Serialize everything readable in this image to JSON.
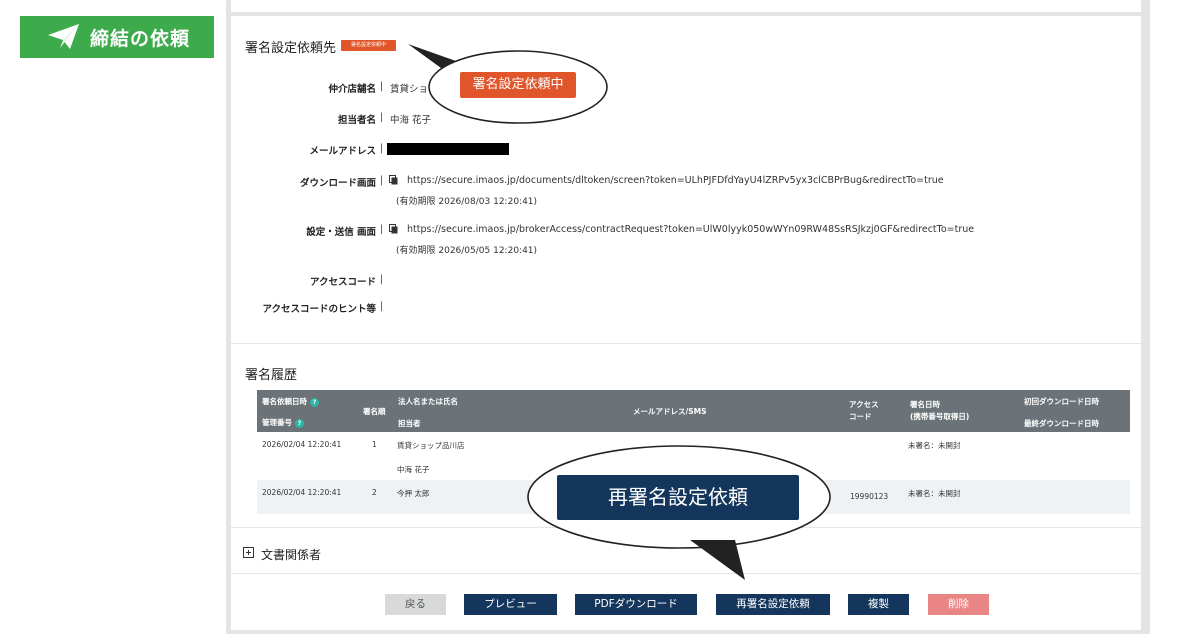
{
  "page_badge": {
    "label": "締結の依頼",
    "icon": "paper-plane-icon"
  },
  "request_section": {
    "title": "署名設定依頼先",
    "status": "署名設定依頼中",
    "fields": {
      "agent_store": {
        "label": "仲介店舗名",
        "value": "賃貸ショッ"
      },
      "person": {
        "label": "担当者名",
        "value": "中海 花子"
      },
      "email": {
        "label": "メールアドレス",
        "value": ""
      },
      "download": {
        "label": "ダウンロード画面",
        "url": "https://secure.imaos.jp/documents/dltoken/screen?token=ULhPJFDfdYayU4lZRPv5yx3clCBPrBug&redirectTo=true",
        "expiry": "(有効期限 2026/08/03 12:20:41)"
      },
      "setting": {
        "label": "設定・送信 画面",
        "url": "https://secure.imaos.jp/brokerAccess/contractRequest?token=UlW0lyyk050wWYn09RW48SsRSJkzj0GF&redirectTo=true",
        "expiry": "(有効期限 2026/05/05 12:20:41)"
      },
      "access_code": {
        "label": "アクセスコード",
        "value": ""
      },
      "access_hint": {
        "label": "アクセスコードのヒント等",
        "value": ""
      }
    },
    "separator": "|"
  },
  "history": {
    "title": "署名履歴",
    "headers": {
      "request_datetime": "署名依頼日時",
      "management_no": "管理番号",
      "order": "署名順",
      "corp_name": "法人名または氏名",
      "person": "担当者",
      "mail": "メールアドレス/SMS",
      "access_code": "アクセスコード",
      "signed_at": "署名日時",
      "signed_at_sub": "(携帯番号取得日)",
      "first_download": "初回ダウンロード日時",
      "last_download": "最終ダウンロード日時",
      "help": "?"
    },
    "rows": [
      {
        "datetime": "2026/02/04 12:20:41",
        "order": "1",
        "name": "賃貸ショップ品川店",
        "person": "中海 花子",
        "access_code": "",
        "status": "未署名：未開封"
      },
      {
        "datetime": "2026/02/04 12:20:41",
        "order": "2",
        "name": "今押 太郎",
        "person": "",
        "access_code": "19990123",
        "status": "未署名：未開封"
      }
    ]
  },
  "doc_related": {
    "label": "文書関係者",
    "icon": "expand-plus-icon"
  },
  "buttons": {
    "back": "戻る",
    "preview": "プレビュー",
    "pdf": "PDFダウンロード",
    "resign": "再署名設定依頼",
    "copy": "複製",
    "delete": "削除"
  },
  "callouts": {
    "status_zoom": "署名設定依頼中",
    "button_zoom": "再署名設定依頼"
  },
  "colors": {
    "badge_green": "#3dab4b",
    "status_orange": "#e0552a",
    "navy": "#14365c",
    "delete_pink": "#e98585",
    "table_header": "#6b7378"
  }
}
